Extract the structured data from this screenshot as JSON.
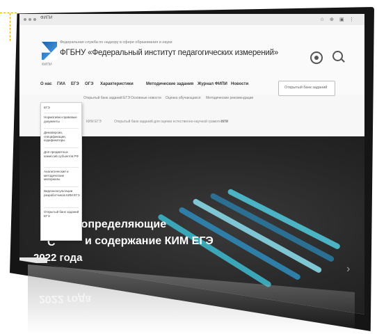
{
  "browser": {
    "tab_title": "ФИПИ",
    "right_icons": [
      "☆",
      "⊕",
      "▣",
      "⋮"
    ]
  },
  "header": {
    "org_subtitle": "Федеральная служба по надзору в сфере образования и науки",
    "org_title": "ФГБНУ «Федеральный институт педагогических измерений»",
    "logo_caption": "ФИПИ"
  },
  "nav": {
    "items": [
      "О нас",
      "ГИА",
      "ЕГЭ",
      "ОГЭ",
      "Характеристики",
      "Методические задания",
      "Журнал ФИПИ",
      "Новости"
    ],
    "button_label": "Открытый банк заданий"
  },
  "subnav": {
    "row1": [
      "Открытый банк заданий ЕГЭ",
      "Основные новости",
      "Оценка обучающихся",
      "Методические рекомендации"
    ],
    "row2": [
      "КИМ ЕГЭ",
      "Открытый банк заданий для оценки естественно-научной грамотности",
      "ВПР"
    ]
  },
  "dropdown": {
    "items": [
      "ЕГЭ",
      "Нормативно-правовые документы",
      "Демоверсии, спецификации, кодификаторы",
      "Для предметных комиссий субъектов РФ",
      "Аналитические и методические материалы",
      "Видеоконсультации разработчиков КИМ ЕГЭ",
      "Открытый банк заданий ЕГЭ"
    ]
  },
  "hero": {
    "title_line1": "Документы, определяющие",
    "title_line1_visible": "Д",
    "title_line1_main": "ы, определяющие",
    "title_line2_start": "С",
    "title_line2_main": "и содержание КИМ ЕГЭ",
    "title_line3": "2022 года",
    "arrow": "›"
  },
  "colors": {
    "accent": "#1f5fa8",
    "pencil_teal": "#3aa6b8",
    "pencil_blue": "#2f7ea8",
    "pencil_light": "#7fc6d4",
    "hero_bg": "#262626"
  }
}
